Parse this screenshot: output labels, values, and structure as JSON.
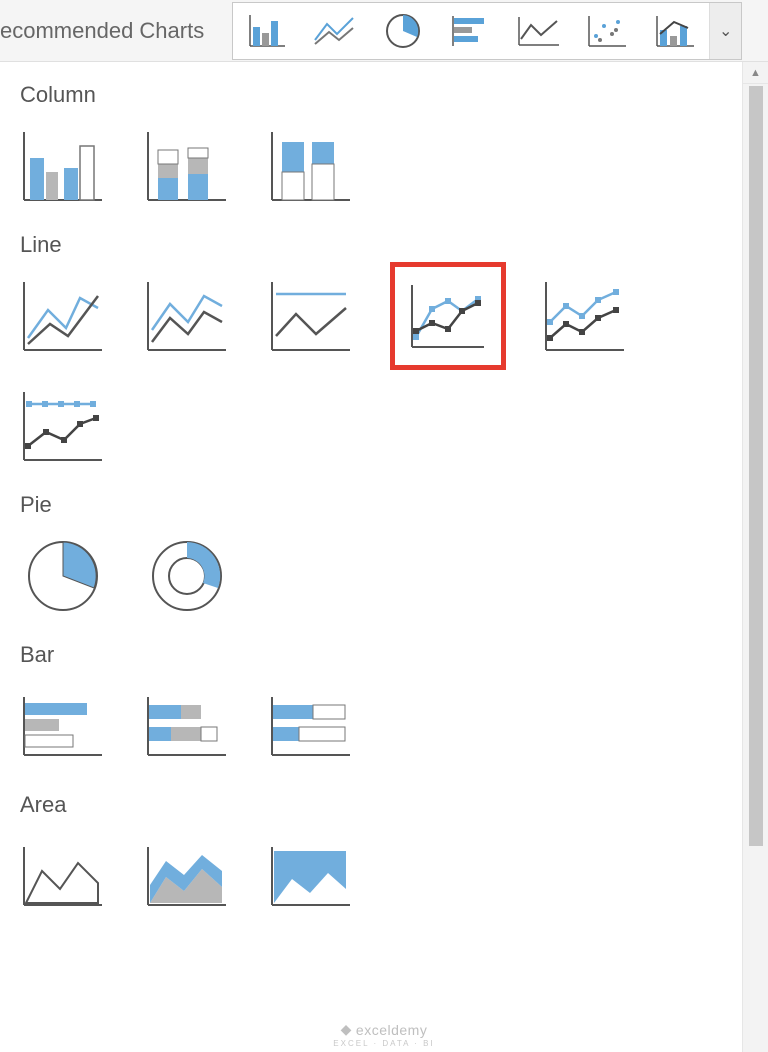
{
  "ribbon": {
    "recommended_label": "ecommended Charts",
    "icons": [
      "column-chart",
      "line-chart",
      "pie-chart",
      "bar-chart",
      "area-chart",
      "scatter-chart",
      "combo-chart"
    ]
  },
  "sections": {
    "column": {
      "title": "Column"
    },
    "line": {
      "title": "Line"
    },
    "pie": {
      "title": "Pie"
    },
    "bar": {
      "title": "Bar"
    },
    "area": {
      "title": "Area"
    }
  },
  "selected_chart": "line-with-markers",
  "watermark": {
    "brand": "exceldemy",
    "tag": "EXCEL · DATA · BI"
  },
  "chart_data": {
    "type": "gallery",
    "note": "Chart type picker gallery — no numeric data series depicted",
    "categories": {
      "Column": [
        "clustered-column",
        "stacked-column",
        "100-stacked-column"
      ],
      "Line": [
        "line",
        "stacked-line",
        "100-stacked-line",
        "line-with-markers",
        "stacked-line-with-markers",
        "100-stacked-line-with-markers"
      ],
      "Pie": [
        "pie",
        "doughnut"
      ],
      "Bar": [
        "clustered-bar",
        "stacked-bar",
        "100-stacked-bar"
      ],
      "Area": [
        "area",
        "stacked-area",
        "100-stacked-area"
      ]
    },
    "highlighted": "line-with-markers"
  }
}
